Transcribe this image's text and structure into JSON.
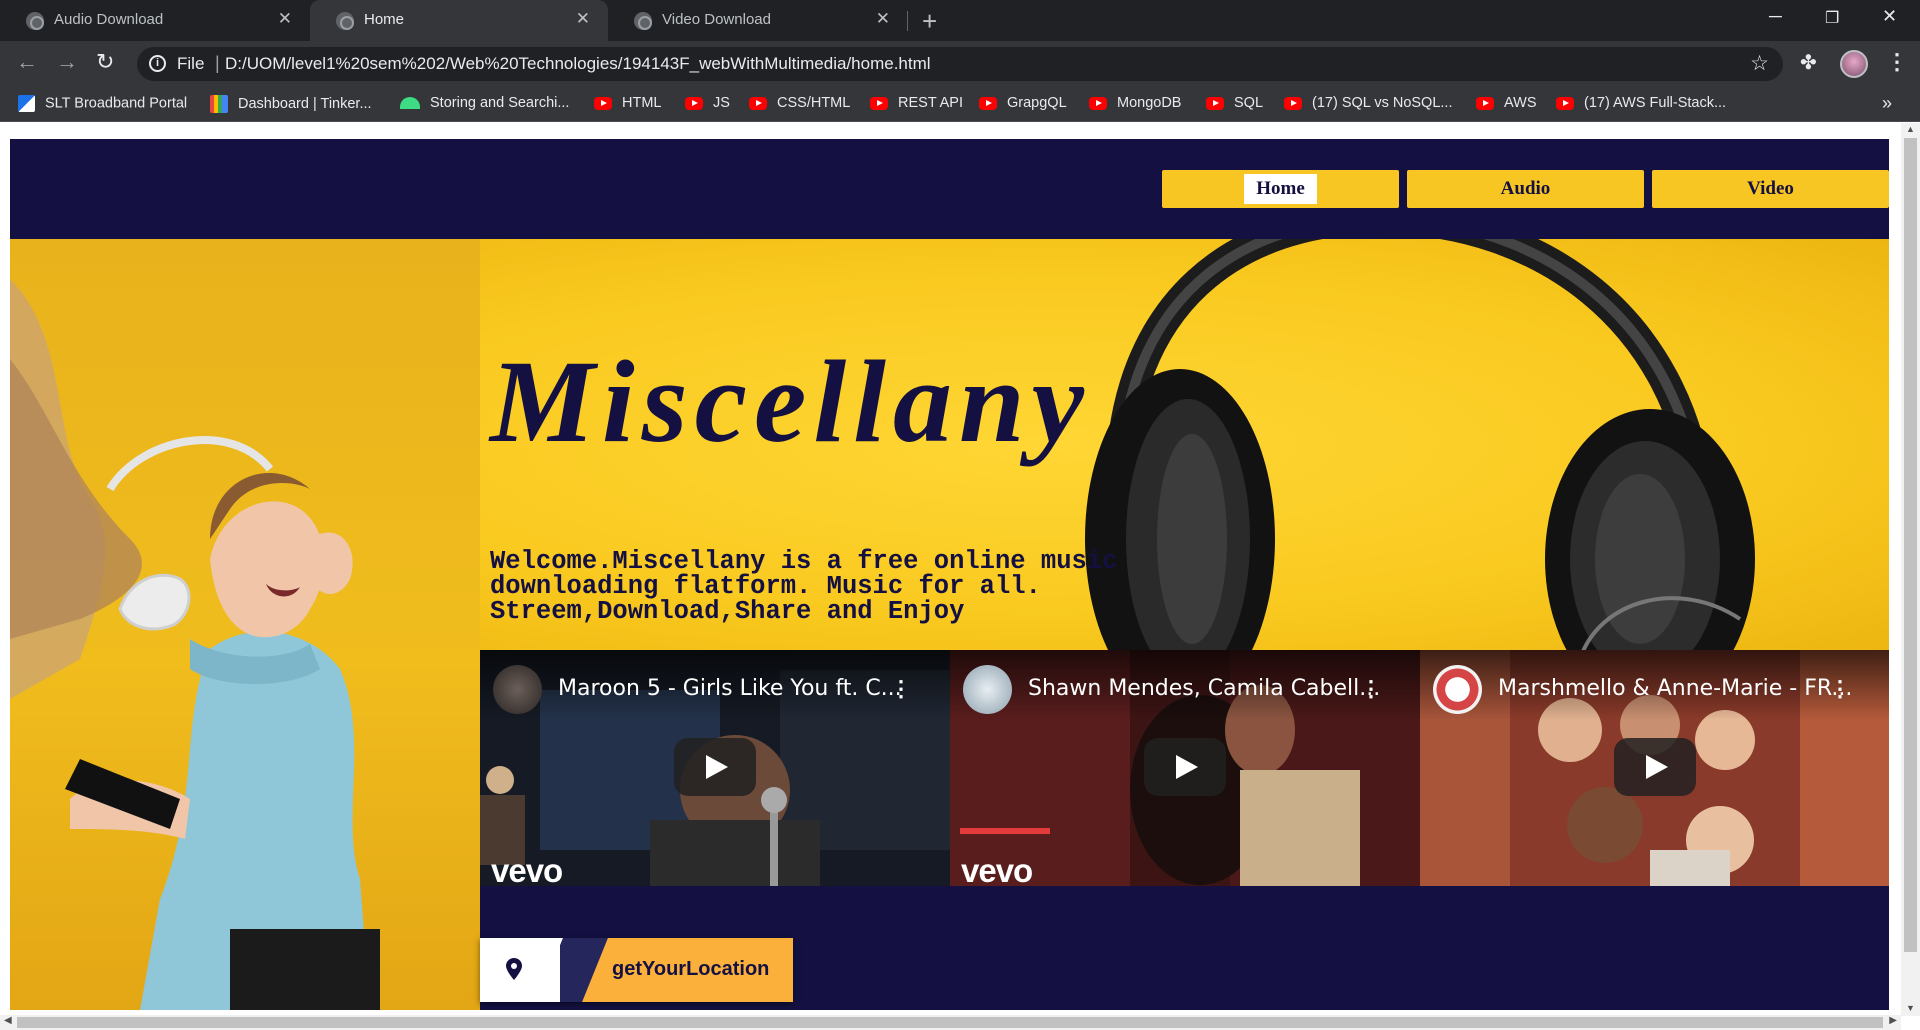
{
  "browser": {
    "tabs": [
      {
        "title": "Audio Download",
        "active": false
      },
      {
        "title": "Home",
        "active": true
      },
      {
        "title": "Video Download",
        "active": false
      }
    ],
    "address": {
      "scheme": "File",
      "url": "D:/UOM/level1%20sem%202/Web%20Technologies/194143F_webWithMultimedia/home.html"
    },
    "bookmarks": [
      {
        "label": "SLT Broadband Portal",
        "icon": "slt-icon"
      },
      {
        "label": "Dashboard | Tinker...",
        "icon": "tinkercad-icon"
      },
      {
        "label": "Storing and Searchi...",
        "icon": "android-icon"
      },
      {
        "label": "HTML",
        "icon": "youtube-icon"
      },
      {
        "label": "JS",
        "icon": "youtube-icon"
      },
      {
        "label": "CSS/HTML",
        "icon": "youtube-icon"
      },
      {
        "label": "REST API",
        "icon": "youtube-icon"
      },
      {
        "label": "GrapgQL",
        "icon": "youtube-icon"
      },
      {
        "label": "MongoDB",
        "icon": "youtube-icon"
      },
      {
        "label": "SQL",
        "icon": "youtube-icon"
      },
      {
        "label": "(17) SQL vs NoSQL...",
        "icon": "youtube-icon"
      },
      {
        "label": "AWS",
        "icon": "youtube-icon"
      },
      {
        "label": "(17) AWS Full-Stack...",
        "icon": "youtube-icon"
      }
    ]
  },
  "site": {
    "nav": [
      {
        "label": "Home",
        "current": true
      },
      {
        "label": "Audio",
        "current": false
      },
      {
        "label": "Video",
        "current": false
      }
    ],
    "title": "Miscellany",
    "intro_lines": [
      "Welcome.Miscellany is a free online music",
      "downloading flatform. Music for all.",
      "Streem,Download,Share and Enjoy"
    ],
    "videos": [
      {
        "title": "Maroon 5 - Girls Like You ft. C...",
        "watermark": "vevo"
      },
      {
        "title": "Shawn Mendes, Camila Cabell...",
        "watermark": "vevo"
      },
      {
        "title": "Marshmello & Anne-Marie - FR...",
        "watermark": ""
      }
    ],
    "location_button": "getYourLocation"
  },
  "colors": {
    "brand_navy": "#141142",
    "brand_yellow": "#f8c622",
    "button_orange": "#fbb03b"
  }
}
